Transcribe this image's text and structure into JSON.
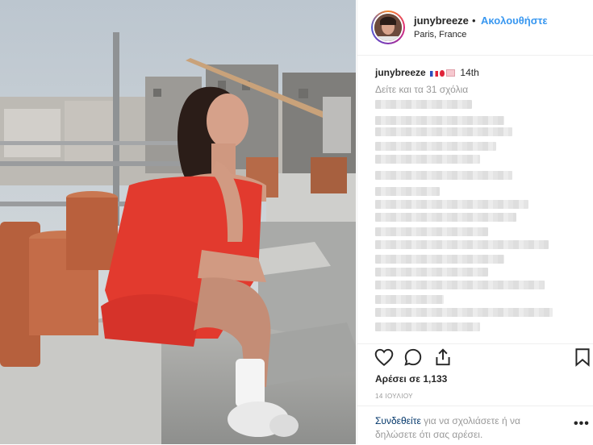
{
  "header": {
    "username": "junybreeze",
    "separator": "•",
    "follow_label": "Ακολουθήστε",
    "location": "Paris, France"
  },
  "caption": {
    "username": "junybreeze",
    "text": "14th",
    "emoji": [
      "french-flag",
      "balloon",
      "love-letter"
    ]
  },
  "comments": {
    "view_all_label": "Δείτε και τα 31 σχόλια"
  },
  "actions": {
    "icons": [
      "heart-icon",
      "comment-icon",
      "share-icon",
      "bookmark-icon"
    ]
  },
  "likes": {
    "label": "Αρέσει σε 1,133"
  },
  "post_date": "14 ΙΟΥΛΙΟΥ",
  "footer": {
    "login_link": "Συνδεθείτε",
    "login_text": " για να σχολιάσετε ή να δηλώσετε ότι σας αρέσει.",
    "more_label": "•••"
  },
  "colors": {
    "link_blue": "#3897f0",
    "dark_link": "#003569",
    "muted": "#999999",
    "text": "#262626",
    "dress_red": "#e23a2e"
  }
}
